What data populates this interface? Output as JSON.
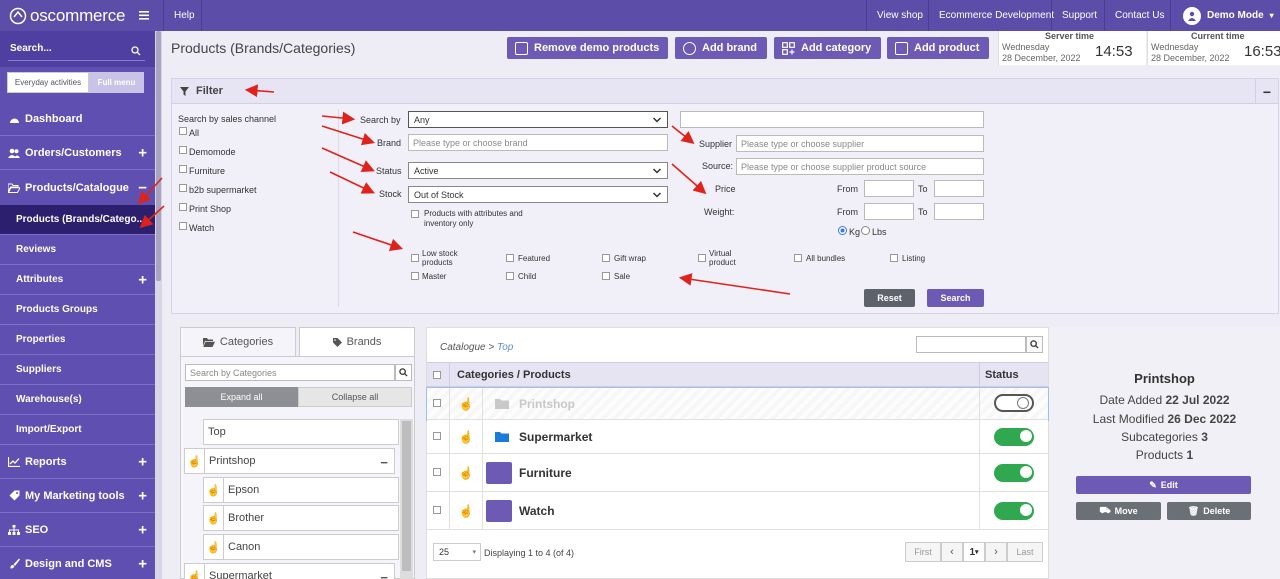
{
  "topbar": {
    "logo": "oscommerce",
    "help": "Help",
    "links": [
      "View shop",
      "Ecommerce Development",
      "Support",
      "Contact Us"
    ],
    "user": "Demo Mode"
  },
  "sidebar": {
    "search_label": "Search...",
    "tab_everyday": "Everyday activities",
    "tab_full": "Full menu",
    "items": {
      "dashboard": "Dashboard",
      "orders": "Orders/Customers",
      "products": "Products/Catalogue",
      "products_sub": "Products (Brands/Catego...",
      "reviews": "Reviews",
      "attributes": "Attributes",
      "groups": "Products Groups",
      "properties": "Properties",
      "suppliers": "Suppliers",
      "warehouses": "Warehouse(s)",
      "import": "Import/Export",
      "reports": "Reports",
      "marketing": "My Marketing tools",
      "seo": "SEO",
      "design": "Design and CMS"
    }
  },
  "header": {
    "title": "Products (Brands/Categories)",
    "buttons": {
      "remove_demo": "Remove demo products",
      "add_brand": "Add brand",
      "add_category": "Add category",
      "add_product": "Add product"
    },
    "server_time": {
      "label": "Server time",
      "day": "Wednesday",
      "date": "28 December, 2022",
      "time": "14:53"
    },
    "current_time": {
      "label": "Current time",
      "day": "Wednesday",
      "date": "28 December, 2022",
      "time": "16:53"
    }
  },
  "filter": {
    "title": "Filter",
    "channel_label": "Search by sales channel",
    "channels": [
      "All",
      "Demomode",
      "Furniture",
      "b2b supermarket",
      "Print Shop",
      "Watch"
    ],
    "search_by_label": "Search by",
    "search_by_value": "Any",
    "brand_label": "Brand",
    "brand_placeholder": "Please type or choose brand",
    "status_label": "Status",
    "status_value": "Active",
    "stock_label": "Stock",
    "stock_value": "Out of Stock",
    "attr_check": "Products with attributes and inventory only",
    "supplier_label": "Supplier",
    "supplier_placeholder": "Please type or choose supplier",
    "source_label": "Source:",
    "source_placeholder": "Please type or choose supplier product source",
    "price_label": "Price",
    "weight_label": "Weight:",
    "from": "From",
    "to": "To",
    "kg": "Kg",
    "lbs": "Lbs",
    "flags_row1": [
      "Low stock products",
      "Featured",
      "Gift wrap",
      "Virtual product",
      "All bundles",
      "Listing"
    ],
    "flags_row2": [
      "Master",
      "Child",
      "Sale"
    ],
    "reset": "Reset",
    "search": "Search"
  },
  "categories": {
    "tab_categories": "Categories",
    "tab_brands": "Brands",
    "search_placeholder": "Search by Categories",
    "expand": "Expand all",
    "collapse": "Collapse all",
    "tree": [
      "Top",
      "Printshop",
      "Epson",
      "Brother",
      "Canon",
      "Supermarket"
    ]
  },
  "products": {
    "breadcrumb_prefix": "Catalogue >",
    "breadcrumb_link": "Top",
    "header_name": "Categories / Products",
    "header_status": "Status",
    "rows": [
      {
        "name": "Printshop",
        "status": "off"
      },
      {
        "name": "Supermarket",
        "status": "on"
      },
      {
        "name": "Furniture",
        "status": "on"
      },
      {
        "name": "Watch",
        "status": "on"
      }
    ],
    "per_page": "25",
    "displaying": "Displaying 1 to 4 (of 4)",
    "first": "First",
    "page": "1",
    "last": "Last"
  },
  "info": {
    "title": "Printshop",
    "date_added_label": "Date Added",
    "date_added": "22 Jul 2022",
    "last_modified_label": "Last Modified",
    "last_modified": "26 Dec 2022",
    "subcategories_label": "Subcategories",
    "subcategories": "3",
    "products_label": "Products",
    "products": "1",
    "edit": "Edit",
    "move": "Move",
    "delete": "Delete"
  }
}
